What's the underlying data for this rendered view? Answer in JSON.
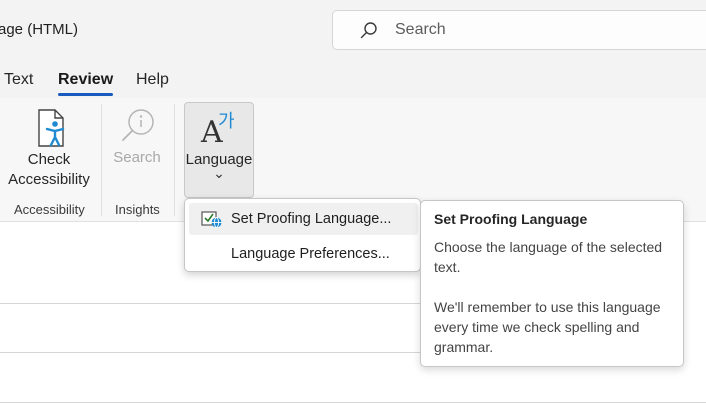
{
  "window": {
    "title": "age (HTML)"
  },
  "search": {
    "placeholder": "Search"
  },
  "tabs": [
    {
      "label": "Text"
    },
    {
      "label": "Review"
    },
    {
      "label": "Help"
    }
  ],
  "ribbon": {
    "check_accessibility": {
      "line1": "Check",
      "line2": "Accessibility",
      "icon": "accessibility-checker-icon"
    },
    "accessibility_group": "Accessibility",
    "search_button": {
      "label": "Search",
      "icon": "search-insight-icon",
      "disabled": true
    },
    "insights_group": "Insights",
    "language_button": {
      "label": "Language",
      "icon": "language-icon",
      "glyph": "A",
      "hangul": "가",
      "chevron": "⌄"
    }
  },
  "menu": {
    "items": [
      {
        "label": "Set Proofing Language...",
        "icon": "proofing-language-icon"
      },
      {
        "label": "Language Preferences..."
      }
    ]
  },
  "tooltip": {
    "title": "Set Proofing Language",
    "body1": "Choose the language of the selected text.",
    "body2": "We'll remember to use this language every time we check spelling and grammar."
  }
}
